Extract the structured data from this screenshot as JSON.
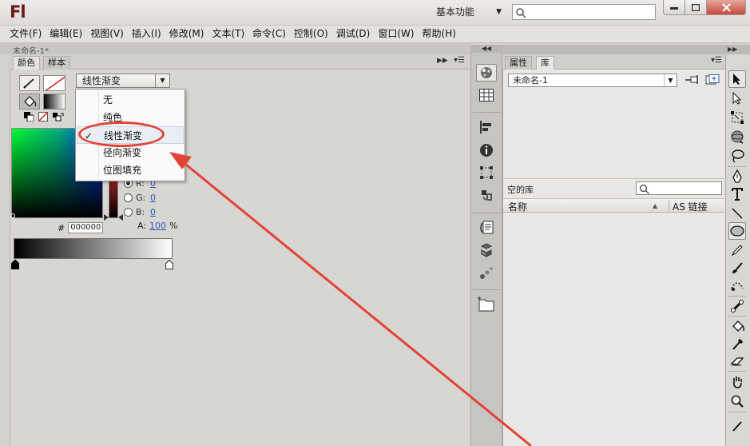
{
  "app": {
    "logo": "Fl",
    "workspace_label": "基本功能",
    "document_tab": "未命名-1*"
  },
  "menu": [
    "文件(F)",
    "编辑(E)",
    "视图(V)",
    "插入(I)",
    "修改(M)",
    "文本(T)",
    "命令(C)",
    "控制(O)",
    "调试(D)",
    "窗口(W)",
    "帮助(H)"
  ],
  "color_panel": {
    "tabs": [
      "颜色",
      "样本"
    ],
    "fill_type": "线性渐变",
    "dropdown_options": [
      "无",
      "纯色",
      "线性渐变",
      "径向渐变",
      "位图填充"
    ],
    "selected_option": "线性渐变",
    "check_mark": "✓",
    "rgb": [
      {
        "label": "R:",
        "value": "0"
      },
      {
        "label": "G:",
        "value": "0"
      },
      {
        "label": "B:",
        "value": "0"
      }
    ],
    "alpha_label": "A:",
    "alpha_value": "100",
    "alpha_unit": "%",
    "hex_label": "#",
    "hex_value": "000000"
  },
  "library_panel": {
    "tabs": [
      "属性",
      "库"
    ],
    "doc_select": "未命名-1",
    "empty_text": "空的库",
    "columns": {
      "name": "名称",
      "linkage": "AS 链接"
    }
  },
  "colors": {
    "annotation_red": "#e24437",
    "logo": "#6b1a1a",
    "link_value": "#2c5fb3"
  },
  "icons": {
    "dock": [
      "color-icon",
      "swatch-grid-icon",
      "align-icon",
      "info-icon",
      "transform-icon",
      "scene-icon",
      "actions-icon",
      "components-icon",
      "motion-presets-icon",
      "project-icon"
    ],
    "tools": [
      "selection-icon",
      "subselection-icon",
      "free-transform-icon",
      "3d-rotation-icon",
      "lasso-icon",
      "pen-icon",
      "text-icon",
      "line-icon",
      "oval-icon",
      "pencil-icon",
      "brush-icon",
      "deco-icon",
      "bone-icon",
      "paint-bucket-icon",
      "eyedropper-icon",
      "eraser-icon",
      "hand-icon",
      "zoom-icon",
      "stroke-color-icon"
    ]
  }
}
